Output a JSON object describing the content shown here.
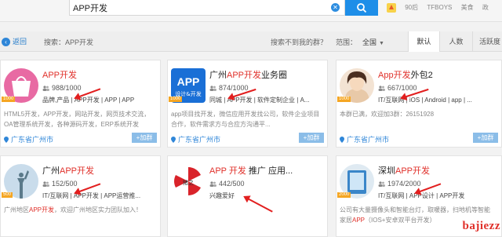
{
  "search": {
    "value": "APP开发"
  },
  "hot": {
    "tags": [
      "90后",
      "TFBOYS",
      "美食",
      "政"
    ]
  },
  "filter": {
    "back": "返回",
    "search_label": "搜索：APP开发",
    "not_found": "搜索不到我的群？",
    "range_label": "范围：",
    "range_value": "全国",
    "sort_tabs": [
      "默认",
      "人数",
      "活跃度"
    ]
  },
  "cards": [
    {
      "title_pre": "",
      "title_hl": "APP开发",
      "title_post": "",
      "members": "988/1000",
      "tags": "品牌,产品 | APP开发 | APP | APP",
      "desc": "HTML5开发，APP开发，网站开发，网页技术交流，OA管理系统开发，各种源码开发，ERP系统开发",
      "location": "广东省广州市",
      "join": "+加群",
      "level": "1000"
    },
    {
      "title_pre": "广州",
      "title_hl": "APP开发",
      "title_post": "业务圈",
      "members": "874/1000",
      "tags": "同城 | APP开发 | 软件定制企业 | A...",
      "desc": "app项目找开发，微信应用开发找公司，软件企业项目合作，软件需求方与合应方沟通平...",
      "location": "广东省广州市",
      "join": "+加群",
      "level": "1000",
      "avatar_text_1": "APP",
      "avatar_text_2": "设计&开发"
    },
    {
      "title_pre": "",
      "title_hl": "App开发",
      "title_post": "外包2",
      "members": "667/1000",
      "tags": "IT/互联网 | iOS | Android | app | ...",
      "desc": "本群已满，欢迎加3群：26151928",
      "location": "广东省广州市",
      "join": "+加群",
      "level": "1000"
    },
    {
      "title_pre": "广州",
      "title_hl": "APP开发",
      "title_post": "",
      "members": "152/500",
      "tags": "IT/互联网 | APP开发 | APP运营推...",
      "desc": "广州地区APP开发，欢迎广州地区实力团队加入！",
      "location": "",
      "join": "",
      "level": "500"
    },
    {
      "title_pre": "",
      "title_hl": "APP 开发",
      "title_post": " 推广 应用...",
      "members": "442/500",
      "tags": "兴趣爱好",
      "desc": "",
      "location": "",
      "join": "",
      "level": "500",
      "avatar_text_1": "猪之"
    },
    {
      "title_pre": "深圳",
      "title_hl": "APP开发",
      "title_post": "",
      "members": "1974/2000",
      "tags": "IT/互联网 | APP设计 | APP开发",
      "desc": "公司有大量摄像头和智能台灯，取暖器，扫地机等智能家居APP（IOS+安卓双平台开发）",
      "location": "",
      "join": "",
      "level": "2000"
    }
  ],
  "watermark": "bajiezz"
}
